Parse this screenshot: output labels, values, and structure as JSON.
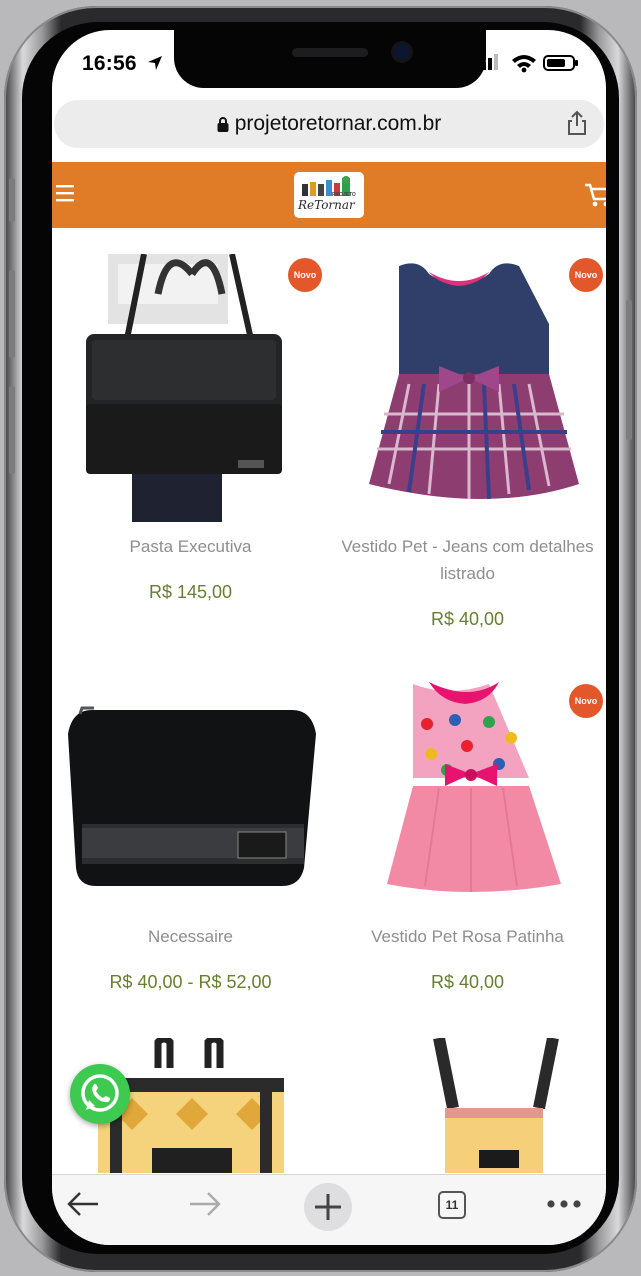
{
  "status_bar": {
    "time": "16:56"
  },
  "browser": {
    "url": "projetoretornar.com.br",
    "tab_count": "11"
  },
  "site": {
    "logo_text": "ReTornar",
    "logo_small": "PROJETO",
    "brand_color": "#e07b28"
  },
  "products": [
    {
      "name": "Pasta Executiva",
      "price": "R$ 145,00",
      "badge": "Novo"
    },
    {
      "name": "Vestido Pet - Jeans com detalhes listrado",
      "price": "R$ 40,00",
      "badge": "Novo"
    },
    {
      "name": "Necessaire",
      "price": "R$ 40,00 - R$ 52,00",
      "badge": ""
    },
    {
      "name": "Vestido Pet Rosa Patinha",
      "price": "R$ 40,00",
      "badge": "Novo"
    }
  ],
  "icons": [
    "location-arrow-icon",
    "signal-icon",
    "wifi-icon",
    "battery-icon",
    "lock-icon",
    "share-icon",
    "menu-icon",
    "cart-icon",
    "whatsapp-icon",
    "back-icon",
    "forward-icon",
    "new-tab-icon",
    "tabs-icon",
    "more-icon"
  ]
}
